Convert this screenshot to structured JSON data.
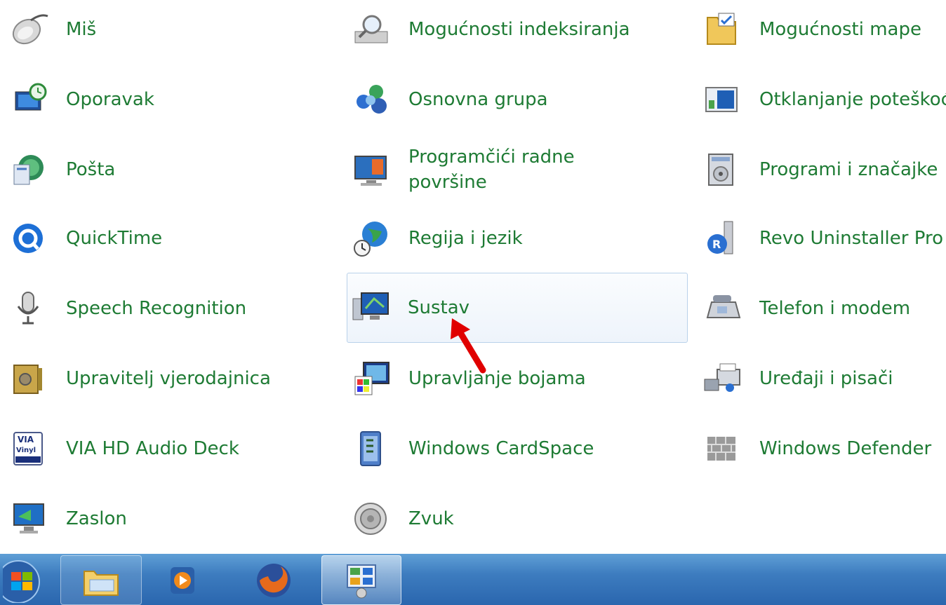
{
  "items": {
    "c0": [
      {
        "label": "Miš",
        "icon": "mouse-icon"
      },
      {
        "label": "Oporavak",
        "icon": "recovery-icon"
      },
      {
        "label": "Pošta",
        "icon": "mail-icon"
      },
      {
        "label": "QuickTime",
        "icon": "quicktime-icon"
      },
      {
        "label": "Speech Recognition",
        "icon": "microphone-icon"
      },
      {
        "label": "Upravitelj vjerodajnica",
        "icon": "credential-safe-icon"
      },
      {
        "label": "VIA HD Audio Deck",
        "icon": "via-vinyl-icon"
      },
      {
        "label": "Zaslon",
        "icon": "display-icon"
      }
    ],
    "c1": [
      {
        "label": "Mogućnosti indeksiranja",
        "icon": "indexing-icon"
      },
      {
        "label": "Osnovna grupa",
        "icon": "homegroup-icon"
      },
      {
        "label": "Programčići radne površine",
        "icon": "gadgets-icon"
      },
      {
        "label": "Regija i jezik",
        "icon": "globe-clock-icon"
      },
      {
        "label": "Sustav",
        "icon": "system-icon"
      },
      {
        "label": "Upravljanje bojama",
        "icon": "color-management-icon"
      },
      {
        "label": "Windows CardSpace",
        "icon": "cardspace-icon"
      },
      {
        "label": "Zvuk",
        "icon": "speaker-icon"
      }
    ],
    "c2": [
      {
        "label": "Mogućnosti mape",
        "icon": "folder-options-icon"
      },
      {
        "label": "Otklanjanje poteškoća",
        "icon": "troubleshooting-icon"
      },
      {
        "label": "Programi i značajke",
        "icon": "programs-icon"
      },
      {
        "label": "Revo Uninstaller Pro",
        "icon": "revo-icon"
      },
      {
        "label": "Telefon i modem",
        "icon": "phone-modem-icon"
      },
      {
        "label": "Uređaji i pisači",
        "icon": "devices-printers-icon"
      },
      {
        "label": "Windows Defender",
        "icon": "defender-wall-icon"
      }
    ]
  },
  "taskbar": {
    "items": [
      {
        "name": "start-orb-icon"
      },
      {
        "name": "explorer-icon"
      },
      {
        "name": "media-player-icon"
      },
      {
        "name": "firefox-icon"
      },
      {
        "name": "control-panel-icon"
      }
    ]
  },
  "colors": {
    "link": "#1e7b34",
    "selection_border": "#b9d1ea",
    "arrow": "#e00000",
    "taskbar": "#3d7cbf"
  }
}
